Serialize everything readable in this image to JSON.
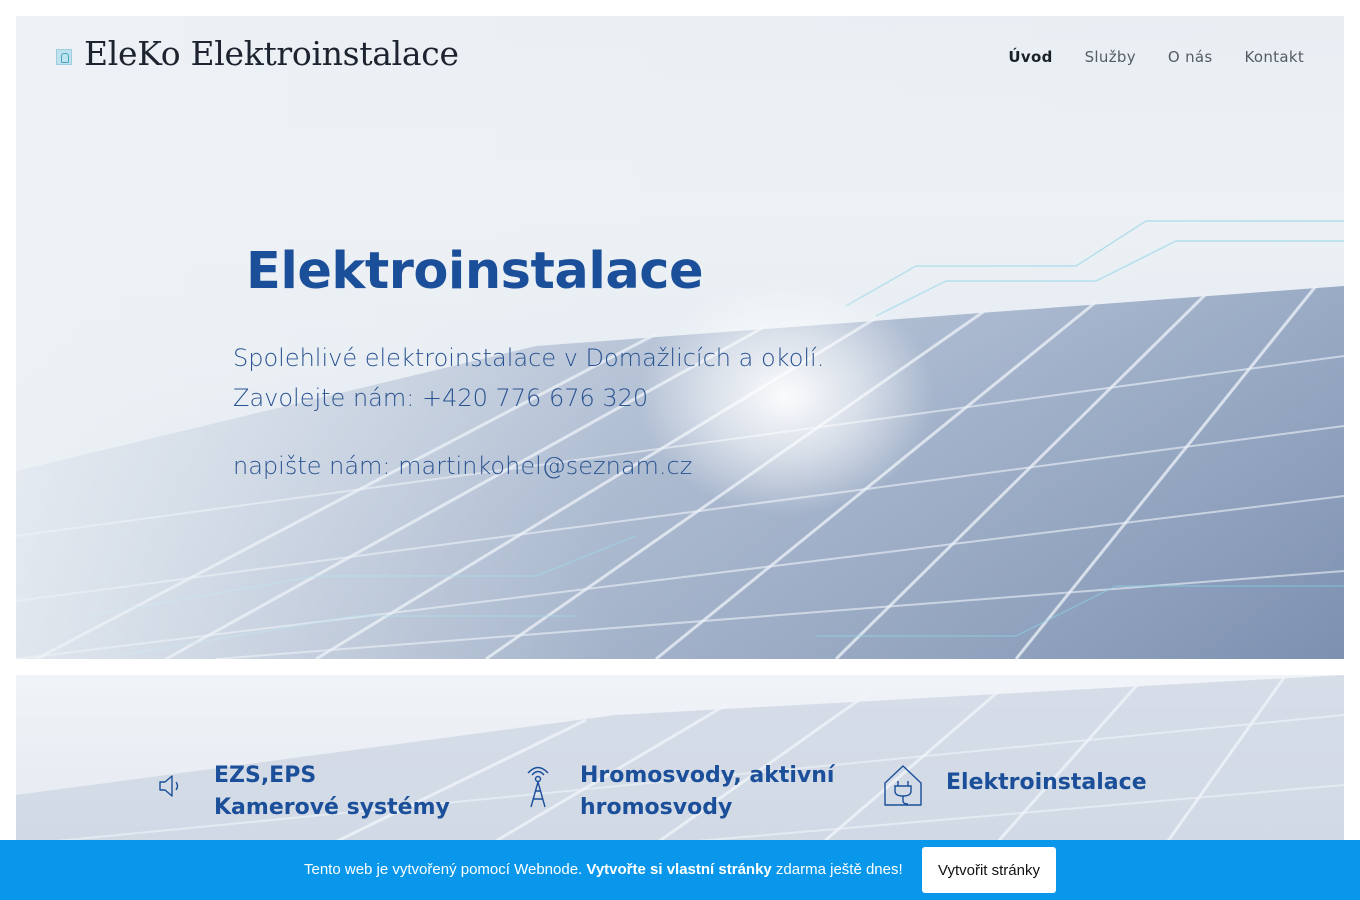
{
  "header": {
    "logo_text": "EleKo Elektroinstalace",
    "nav": [
      {
        "label": "Úvod",
        "active": true
      },
      {
        "label": "Služby",
        "active": false
      },
      {
        "label": "O nás",
        "active": false
      },
      {
        "label": "Kontakt",
        "active": false
      }
    ]
  },
  "hero": {
    "title": "Elektroinstalace",
    "line1": "Spolehlivé elektroinstalace v Domažlicích a okolí.",
    "line2": "Zavolejte nám: +420 776 676 320",
    "line3": "napište nám: martinkohel@seznam.cz"
  },
  "services": [
    {
      "icon": "speaker-icon",
      "line1": "EZS,EPS",
      "line2": "Kamerové systémy"
    },
    {
      "icon": "antenna-tower-icon",
      "line1": "Hromosvody, aktivní",
      "line2": "hromosvody"
    },
    {
      "icon": "house-plug-icon",
      "line1": "Elektroinstalace",
      "line2": ""
    }
  ],
  "promo": {
    "text_before": "Tento web je vytvořený pomocí Webnode. ",
    "text_bold": "Vytvořte si vlastní stránky",
    "text_after": " zdarma ještě dnes!",
    "button_label": "Vytvořit stránky"
  },
  "colors": {
    "accent": "#1b4f99",
    "promo_bar": "#0897ea"
  }
}
